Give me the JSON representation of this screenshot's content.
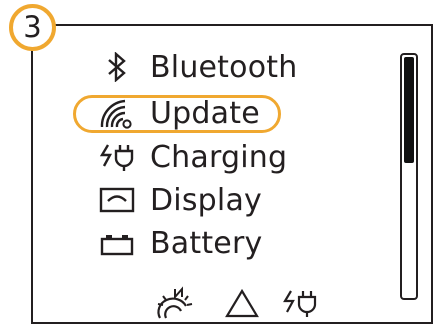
{
  "step": {
    "number": "3"
  },
  "menu": {
    "items": [
      {
        "label": "Bluetooth",
        "icon": "bluetooth-icon"
      },
      {
        "label": "Update",
        "icon": "update-signal-icon",
        "selected": true
      },
      {
        "label": "Charging",
        "icon": "charging-plug-icon"
      },
      {
        "label": "Display",
        "icon": "display-icon"
      },
      {
        "label": "Battery",
        "icon": "battery-icon"
      }
    ]
  },
  "status_bar": {
    "icons": [
      "sleep-mode-icon",
      "warning-triangle-icon",
      "charging-plug-icon"
    ]
  },
  "scrollbar": {
    "position_fraction": 0.0,
    "visible_fraction": 0.43
  },
  "colors": {
    "highlight": "#f0a830",
    "foreground": "#231f20",
    "background": "#ffffff"
  }
}
